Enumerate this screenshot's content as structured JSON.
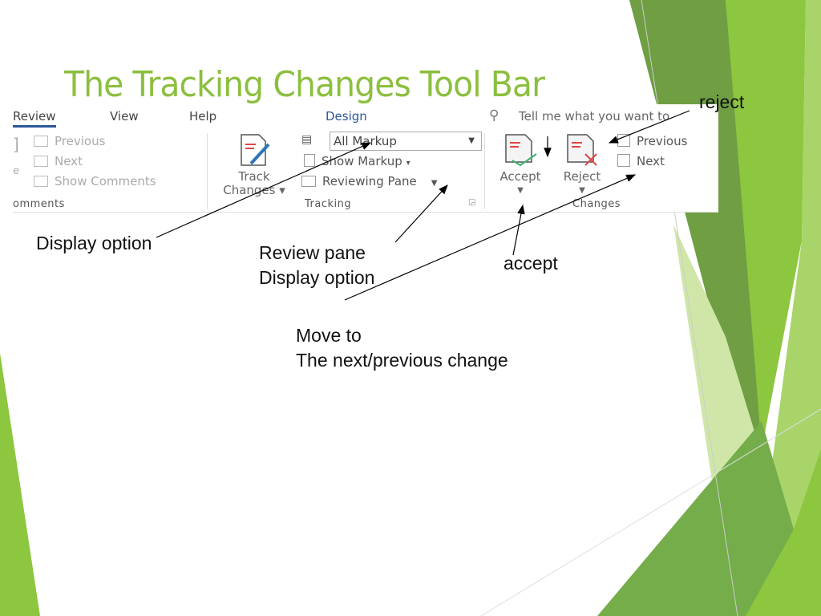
{
  "slide": {
    "title": "The Tracking Changes Tool Bar",
    "colors": {
      "title": "#8cbf3f",
      "accent_dark": "#6f9e43",
      "accent_light": "#8dc63f",
      "ribbon_blue": "#2b579a"
    }
  },
  "ribbon": {
    "tabs": [
      {
        "label": "Review",
        "active": true
      },
      {
        "label": "View"
      },
      {
        "label": "Help"
      },
      {
        "label": "Design"
      }
    ],
    "search_placeholder": "Tell me what you want to",
    "comments": {
      "group_label": "omments",
      "items": [
        "Previous",
        "Next",
        "Show Comments"
      ],
      "partial_left": "e"
    },
    "tracking": {
      "group_label": "Tracking",
      "track_changes": [
        "Track",
        "Changes"
      ],
      "markup_dropdown": "All Markup",
      "show_markup": "Show Markup",
      "reviewing_pane": "Reviewing Pane"
    },
    "changes": {
      "group_label": "Changes",
      "accept": "Accept",
      "reject": "Reject",
      "previous": "Previous",
      "next": "Next"
    }
  },
  "annotations": {
    "reject": "reject",
    "display_option": "Display option",
    "review_pane": [
      "Review pane",
      "Display option"
    ],
    "accept": "accept",
    "move_to": [
      "Move to",
      "The next/previous change"
    ]
  }
}
